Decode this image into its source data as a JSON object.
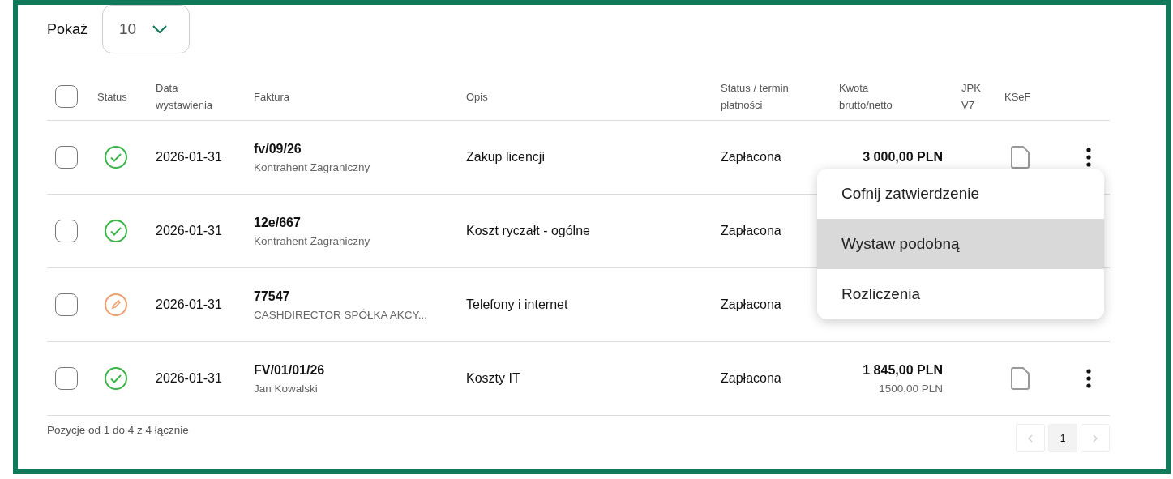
{
  "page_size": {
    "label": "Pokaż",
    "value": "10"
  },
  "table": {
    "columns": [
      "Status",
      "Data wystawienia",
      "Faktura",
      "Opis",
      "Status / termin płatności",
      "Kwota brutto/netto",
      "JPK V7",
      "KSeF"
    ],
    "select_all": {
      "checked": false
    },
    "rows": [
      {
        "checked": false,
        "kind": "approved",
        "date": "2026-01-31",
        "invoice": "fv/09/26",
        "contractor": "Kontrahent Zagraniczny",
        "description": "Zakup licencji",
        "payment": "Zapłacona",
        "gross": "3 000,00 PLN",
        "ksef_document": true,
        "actions": true
      },
      {
        "checked": false,
        "kind": "approved",
        "date": "2026-01-31",
        "invoice": "12e/667",
        "contractor": "Kontrahent Zagraniczny",
        "description": "Koszt ryczałt - ogólne",
        "payment": "Zapłacona"
      },
      {
        "checked": false,
        "kind": "draft",
        "date": "2026-01-31",
        "invoice": "77547",
        "contractor": "CASHDIRECTOR SPÓŁKA AKCY...",
        "description": "Telefony i internet",
        "payment": "Zapłacona"
      },
      {
        "checked": false,
        "kind": "approved",
        "date": "2026-01-31",
        "invoice": "FV/01/01/26",
        "contractor": "Jan Kowalski",
        "description": "Koszty IT",
        "payment": "Zapłacona",
        "gross": "1 845,00 PLN",
        "net": "1500,00 PLN",
        "ksef_document": true,
        "actions": true
      }
    ]
  },
  "context_menu": {
    "items": [
      {
        "label": "Cofnij zatwierdzenie",
        "highlighted": false
      },
      {
        "label": "Wystaw podobną",
        "highlighted": true
      },
      {
        "label": "Rozliczenia",
        "highlighted": false
      }
    ]
  },
  "footer": {
    "summary": "Pozycje od 1 do 4 z 4 łącznie",
    "pages": [
      {
        "label": "1",
        "selected": true
      }
    ]
  }
}
